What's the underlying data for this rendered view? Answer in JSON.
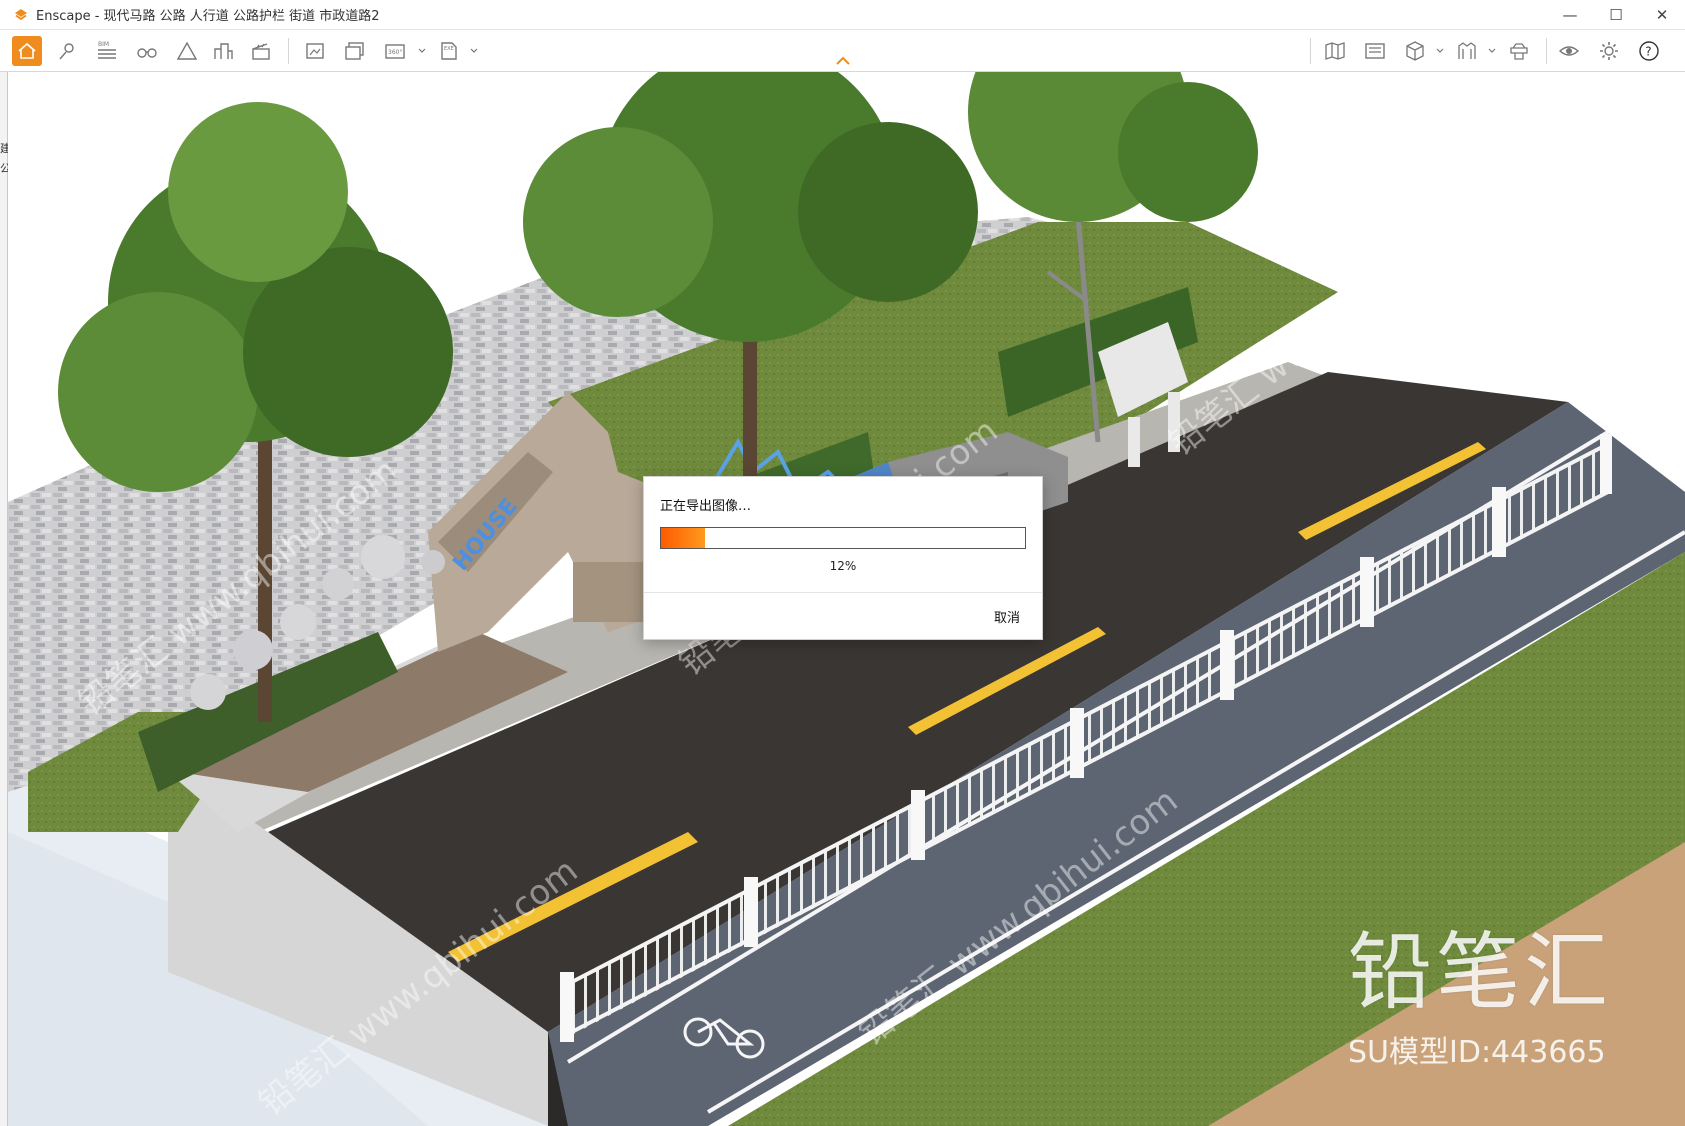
{
  "window": {
    "title": "Enscape - 现代马路 公路 人行道 公路护栏 街道 市政道路2",
    "controls": {
      "minimize": "—",
      "maximize": "☐",
      "close": "✕"
    }
  },
  "toolbar": {
    "bim_label": "BIM",
    "view360_label": "360°",
    "exe_label": "EXE",
    "help_label": "?",
    "items": [
      "home-icon",
      "location-pin-icon",
      "bim-list-icon",
      "binoculars-icon",
      "mountain-icon",
      "buildings-icon",
      "clapperboard-icon",
      "screenshot-icon",
      "batch-render-icon",
      "panorama-360-icon",
      "export-exe-icon",
      "map-icon",
      "image-gallery-icon",
      "cube-icon",
      "asset-library-icon",
      "material-icon",
      "eye-icon",
      "settings-icon",
      "help-icon"
    ]
  },
  "side_strip": {
    "glyphs": [
      "建",
      "公"
    ]
  },
  "dialog": {
    "title": "正在导出图像…",
    "progress": 0.12,
    "progress_text": "12%",
    "cancel_label": "取消"
  },
  "watermark": {
    "brand": "铅笔汇",
    "model_id": "SU模型ID:443665",
    "tile_text": "铅笔汇 www.qbihui.com"
  },
  "colors": {
    "accent": "#f08c1e",
    "progress": "#ff6a00",
    "asphalt": "#3a3633",
    "bike_lane": "#5d6472",
    "grass": "#6f8a3c",
    "lane_marking": "#f2c234"
  }
}
